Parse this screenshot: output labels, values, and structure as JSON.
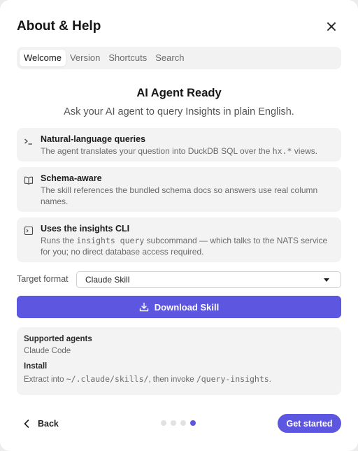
{
  "dialog": {
    "title": "About & Help"
  },
  "tabs": [
    {
      "label": "Welcome",
      "active": true
    },
    {
      "label": "Version",
      "active": false
    },
    {
      "label": "Shortcuts",
      "active": false
    },
    {
      "label": "Search",
      "active": false
    }
  ],
  "hero": {
    "title": "AI Agent Ready",
    "subtitle": "Ask your AI agent to query Insights in plain English."
  },
  "features": [
    {
      "icon": "terminal-prompt-icon",
      "title": "Natural-language queries",
      "body_pre": "The agent translates your question into DuckDB SQL over the ",
      "body_code": "hx.*",
      "body_post": " views."
    },
    {
      "icon": "book-icon",
      "title": "Schema-aware",
      "body": "The skill references the bundled schema docs so answers use real column names."
    },
    {
      "icon": "terminal-window-icon",
      "title": "Uses the insights CLI",
      "body_pre": "Runs the ",
      "body_code": "insights query",
      "body_post": " subcommand — which talks to the NATS service for you; no direct database access required."
    }
  ],
  "format": {
    "label": "Target format",
    "selected": "Claude Skill"
  },
  "download_button": {
    "label": "Download Skill",
    "icon": "download-icon"
  },
  "info": {
    "agents_label": "Supported agents",
    "agents_value": "Claude Code",
    "install_label": "Install",
    "install_pre": "Extract into ",
    "install_path": "~/.claude/skills/",
    "install_mid": ", then invoke ",
    "install_cmd": "/query-insights",
    "install_post": "."
  },
  "footer": {
    "back_label": "Back",
    "next_label": "Get started",
    "page_count": 4,
    "current_page": 4
  },
  "colors": {
    "accent": "#5d56e0",
    "card_bg": "#f3f3f3"
  }
}
